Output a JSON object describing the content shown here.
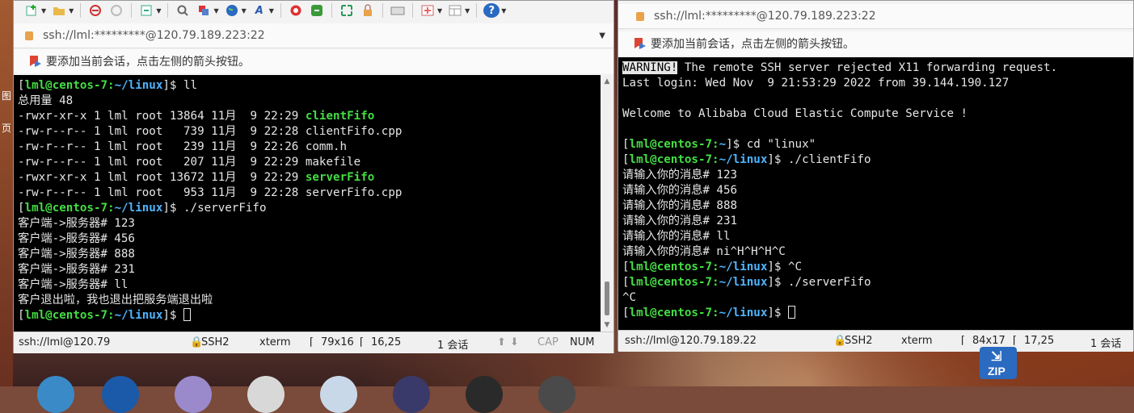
{
  "left": {
    "address": "ssh://lml:*********@120.79.189.223:22",
    "hint": "要添加当前会话，点击左侧的箭头按钮。",
    "terminal": {
      "lines": [
        [
          {
            "t": "[",
            "c": ""
          },
          {
            "t": "lml@centos-7:",
            "c": "g"
          },
          {
            "t": "~/linux",
            "c": "c"
          },
          {
            "t": "]$ ll",
            "c": ""
          }
        ],
        [
          {
            "t": "总用量 48",
            "c": ""
          }
        ],
        [
          {
            "t": "-rwxr-xr-x 1 lml root 13864 11月  9 22:29 ",
            "c": ""
          },
          {
            "t": "clientFifo",
            "c": "g"
          }
        ],
        [
          {
            "t": "-rw-r--r-- 1 lml root   739 11月  9 22:28 clientFifo.cpp",
            "c": ""
          }
        ],
        [
          {
            "t": "-rw-r--r-- 1 lml root   239 11月  9 22:26 comm.h",
            "c": ""
          }
        ],
        [
          {
            "t": "-rw-r--r-- 1 lml root   207 11月  9 22:29 makefile",
            "c": ""
          }
        ],
        [
          {
            "t": "-rwxr-xr-x 1 lml root 13672 11月  9 22:29 ",
            "c": ""
          },
          {
            "t": "serverFifo",
            "c": "g"
          }
        ],
        [
          {
            "t": "-rw-r--r-- 1 lml root   953 11月  9 22:28 serverFifo.cpp",
            "c": ""
          }
        ],
        [
          {
            "t": "[",
            "c": ""
          },
          {
            "t": "lml@centos-7:",
            "c": "g"
          },
          {
            "t": "~/linux",
            "c": "c"
          },
          {
            "t": "]$ ./serverFifo",
            "c": ""
          }
        ],
        [
          {
            "t": "客户端->服务器# 123",
            "c": ""
          }
        ],
        [
          {
            "t": "客户端->服务器# 456",
            "c": ""
          }
        ],
        [
          {
            "t": "客户端->服务器# 888",
            "c": ""
          }
        ],
        [
          {
            "t": "客户端->服务器# 231",
            "c": ""
          }
        ],
        [
          {
            "t": "客户端->服务器# ll",
            "c": ""
          }
        ],
        [
          {
            "t": "客户退出啦，我也退出把服务端退出啦",
            "c": ""
          }
        ],
        [
          {
            "t": "[",
            "c": ""
          },
          {
            "t": "lml@centos-7:",
            "c": "g"
          },
          {
            "t": "~/linux",
            "c": "c"
          },
          {
            "t": "]$ ",
            "c": ""
          },
          {
            "t": "",
            "c": "cursor"
          }
        ]
      ]
    },
    "status": {
      "session": "ssh://lml@120.79",
      "protocol": "SSH2",
      "termtype": "xterm",
      "size": "79x16",
      "pos": "16,25",
      "sessions": "1 会话",
      "cap": "CAP",
      "num": "NUM"
    }
  },
  "right": {
    "address": "ssh://lml:*********@120.79.189.223:22",
    "hint": "要添加当前会话，点击左侧的箭头按钮。",
    "terminal": {
      "lines": [
        [
          {
            "t": "WARNING!",
            "c": "wb"
          },
          {
            "t": " The remote SSH server rejected X11 forwarding request.",
            "c": ""
          }
        ],
        [
          {
            "t": "Last login: Wed Nov  9 21:53:29 2022 from 39.144.190.127",
            "c": ""
          }
        ],
        [
          {
            "t": "",
            "c": ""
          }
        ],
        [
          {
            "t": "Welcome to Alibaba Cloud Elastic Compute Service !",
            "c": ""
          }
        ],
        [
          {
            "t": "",
            "c": ""
          }
        ],
        [
          {
            "t": "[",
            "c": ""
          },
          {
            "t": "lml@centos-7:",
            "c": "g"
          },
          {
            "t": "~",
            "c": "c"
          },
          {
            "t": "]$ cd \"linux\"",
            "c": ""
          }
        ],
        [
          {
            "t": "[",
            "c": ""
          },
          {
            "t": "lml@centos-7:",
            "c": "g"
          },
          {
            "t": "~/linux",
            "c": "c"
          },
          {
            "t": "]$ ./clientFifo",
            "c": ""
          }
        ],
        [
          {
            "t": "请输入你的消息# 123",
            "c": ""
          }
        ],
        [
          {
            "t": "请输入你的消息# 456",
            "c": ""
          }
        ],
        [
          {
            "t": "请输入你的消息# 888",
            "c": ""
          }
        ],
        [
          {
            "t": "请输入你的消息# 231",
            "c": ""
          }
        ],
        [
          {
            "t": "请输入你的消息# ll",
            "c": ""
          }
        ],
        [
          {
            "t": "请输入你的消息# ni^H^H^H^C",
            "c": ""
          }
        ],
        [
          {
            "t": "[",
            "c": ""
          },
          {
            "t": "lml@centos-7:",
            "c": "g"
          },
          {
            "t": "~/linux",
            "c": "c"
          },
          {
            "t": "]$ ^C",
            "c": ""
          }
        ],
        [
          {
            "t": "[",
            "c": ""
          },
          {
            "t": "lml@centos-7:",
            "c": "g"
          },
          {
            "t": "~/linux",
            "c": "c"
          },
          {
            "t": "]$ ./serverFifo",
            "c": ""
          }
        ],
        [
          {
            "t": "^C",
            "c": ""
          }
        ],
        [
          {
            "t": "[",
            "c": ""
          },
          {
            "t": "lml@centos-7:",
            "c": "g"
          },
          {
            "t": "~/linux",
            "c": "c"
          },
          {
            "t": "]$ ",
            "c": ""
          },
          {
            "t": "",
            "c": "cursor"
          }
        ]
      ]
    },
    "status": {
      "session": "ssh://lml@120.79.189.22",
      "protocol": "SSH2",
      "termtype": "xterm",
      "size": "84x17",
      "pos": "17,25",
      "sessions": "1 会话"
    }
  },
  "desktop": {
    "zip_label": "ZIP",
    "side_chars": [
      "图",
      "页"
    ]
  },
  "icons": {
    "toolbar": [
      "new-session-icon",
      "open-folder-icon",
      "connect-icon",
      "disconnect-icon",
      "settings-icon",
      "find-icon",
      "properties-icon",
      "globe-icon",
      "font-icon",
      "sftp-icon",
      "xftp-icon",
      "fullscreen-icon",
      "lock-icon",
      "keyboard-icon",
      "add-icon",
      "layout-icon",
      "help-icon"
    ]
  }
}
